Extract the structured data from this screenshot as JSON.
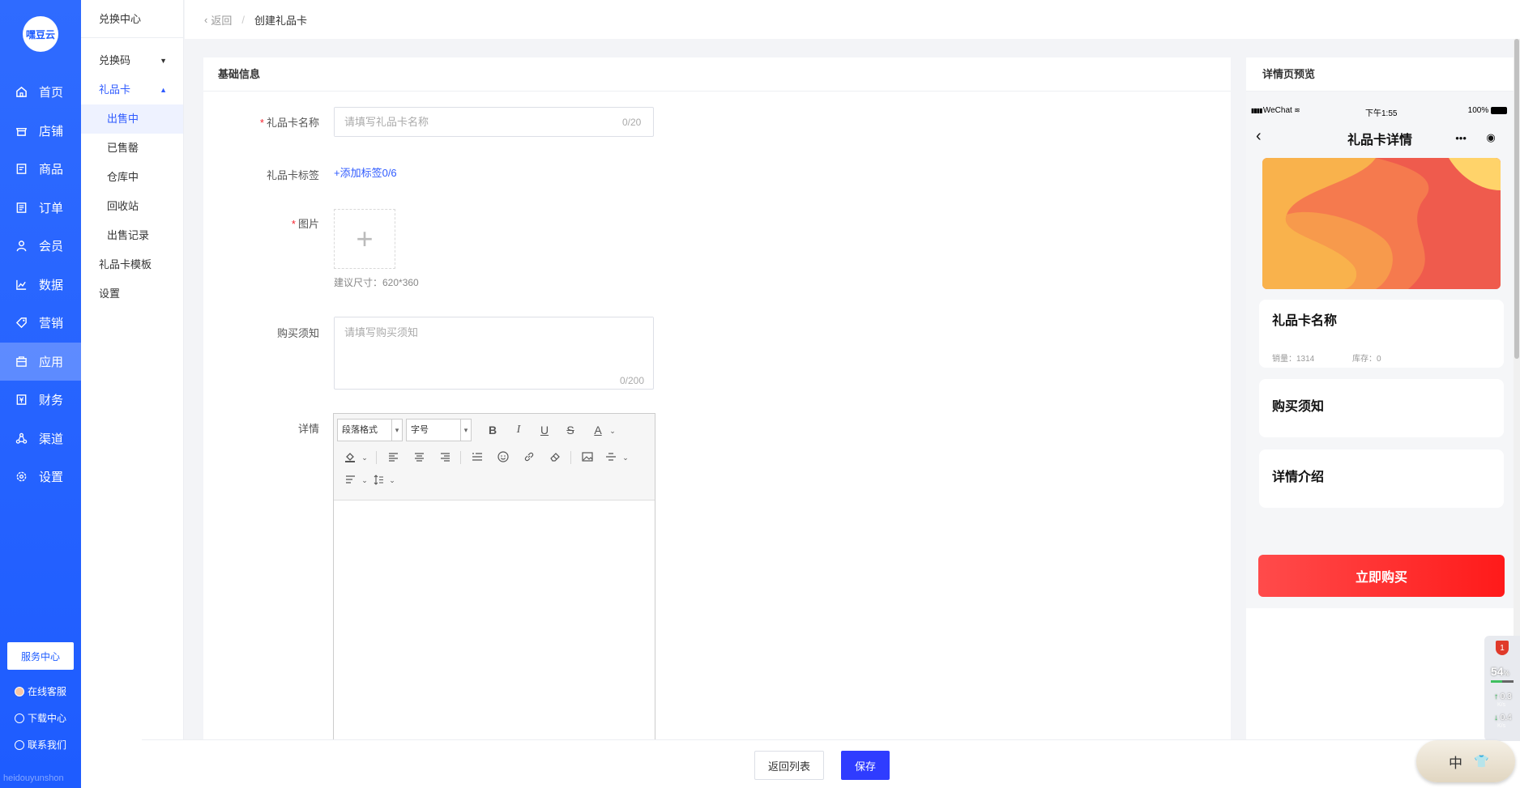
{
  "brand": {
    "logo_text": "嘿豆云",
    "footer": "heidouyunshon"
  },
  "nav": [
    {
      "label": "首页",
      "icon": "home-icon"
    },
    {
      "label": "店铺",
      "icon": "store-icon"
    },
    {
      "label": "商品",
      "icon": "goods-icon"
    },
    {
      "label": "订单",
      "icon": "order-icon"
    },
    {
      "label": "会员",
      "icon": "member-icon"
    },
    {
      "label": "数据",
      "icon": "chart-icon"
    },
    {
      "label": "营销",
      "icon": "tag-icon"
    },
    {
      "label": "应用",
      "icon": "app-icon",
      "active": true
    },
    {
      "label": "财务",
      "icon": "finance-icon"
    },
    {
      "label": "渠道",
      "icon": "channel-icon"
    },
    {
      "label": "设置",
      "icon": "settings-icon"
    }
  ],
  "side_links": {
    "service_center": "服务中心",
    "online_support": "在线客服",
    "download_center": "下载中心",
    "contact_us": "联系我们"
  },
  "submenu": {
    "head": "兑换中心",
    "redeem_code": "兑换码",
    "gift_card": "礼品卡",
    "children": [
      "出售中",
      "已售罄",
      "仓库中",
      "回收站",
      "出售记录"
    ],
    "active_child": "出售中",
    "template": "礼品卡模板",
    "settings": "设置"
  },
  "breadcrumb": {
    "back": "返回",
    "current": "创建礼品卡"
  },
  "form": {
    "section_title": "基础信息",
    "name_label": "礼品卡名称",
    "name_placeholder": "请填写礼品卡名称",
    "name_counter": "0/20",
    "tags_label": "礼品卡标签",
    "add_tag": "+添加标签0/6",
    "image_label": "图片",
    "image_hint": "建议尺寸：620*360",
    "notice_label": "购买须知",
    "notice_placeholder": "请填写购买须知",
    "notice_counter": "0/200",
    "detail_label": "详情",
    "editor": {
      "paragraph_select": "段落格式",
      "font_size_select": "字号"
    }
  },
  "actions": {
    "back_to_list": "返回列表",
    "save": "保存"
  },
  "preview": {
    "title": "详情页预览",
    "status_left": "WeChat",
    "status_time": "下午1:55",
    "status_battery": "100%",
    "page_title": "礼品卡详情",
    "card_name": "礼品卡名称",
    "sales": "销量：1314",
    "stock": "库存：0",
    "notice_heading": "购买须知",
    "detail_heading": "详情介绍",
    "buy_button": "立即购买"
  },
  "system": {
    "alert_count": "1",
    "cpu": "54",
    "cpu_unit": "%",
    "upload_speed": "0.3",
    "download_speed": "0.4",
    "speed_unit": "K/s",
    "ime_lang": "中"
  },
  "colors": {
    "sidebar": "#1e5cff",
    "accent": "#2f5bff",
    "primary_button": "#2f3cff",
    "buy_button": "#ff2a2a"
  }
}
